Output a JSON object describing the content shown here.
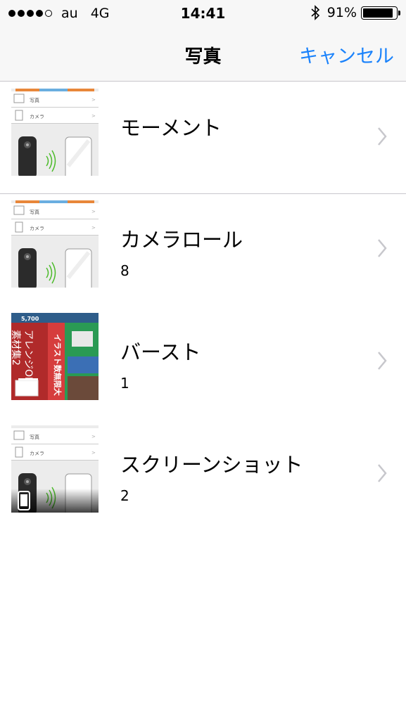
{
  "status_bar": {
    "signal_bars": 4,
    "signal_max": 5,
    "carrier": "au",
    "network": "4G",
    "time": "14:41",
    "bluetooth_icon": "bluetooth-icon",
    "battery": "91%",
    "battery_level": 0.91
  },
  "nav": {
    "title": "写真",
    "cancel": "キャンセル",
    "accent_color": "#1a82fb"
  },
  "albums": [
    {
      "title": "モーメント",
      "count": "",
      "thumb": "screenshot-thumb"
    },
    {
      "title": "カメラロール",
      "count": "8",
      "thumb": "screenshot-thumb"
    },
    {
      "title": "バースト",
      "count": "1",
      "thumb": "photo-thumb"
    },
    {
      "title": "スクリーンショット",
      "count": "2",
      "thumb": "screenshot-thumb"
    }
  ],
  "thumb_text": {
    "row1": "写真",
    "row2": "カメラ",
    "burst_banner": "5,700",
    "burst_sign1": "イラスト数無限大",
    "burst_sign2": "アレンジOK",
    "burst_sign3": "素材集2"
  }
}
